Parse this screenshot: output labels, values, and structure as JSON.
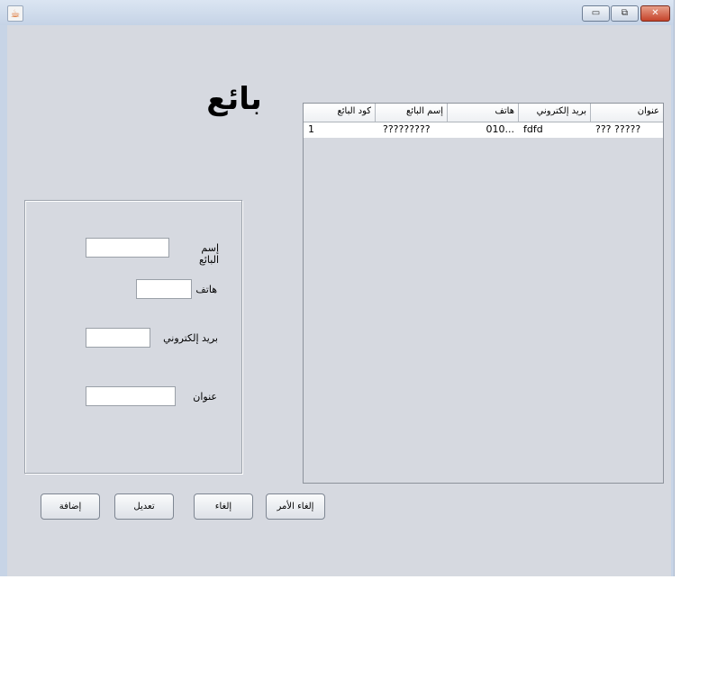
{
  "window": {
    "app_icon": "java-icon",
    "minimize_symbol": "▭",
    "maximize_symbol": "⧉",
    "close_symbol": "✕"
  },
  "page_title": "بائع",
  "form": {
    "name_label": "إسم البائع",
    "name_value": "",
    "phone_label": "هاتف",
    "phone_value": "",
    "email_label": "بريد إلكتروني",
    "email_value": "",
    "address_label": "عنوان",
    "address_value": ""
  },
  "table": {
    "columns": [
      "كود البائع",
      "إسم البائع",
      "هاتف",
      "بريد إلكتروني",
      "عنوان"
    ],
    "rows": [
      [
        "1",
        "?????????",
        "010...",
        "fdfd",
        "??? ?????"
      ]
    ]
  },
  "buttons": {
    "cancel_command": "إلغاء الأمر",
    "delete": "إلغاء",
    "edit": "تعديل",
    "add": "إضافة"
  }
}
